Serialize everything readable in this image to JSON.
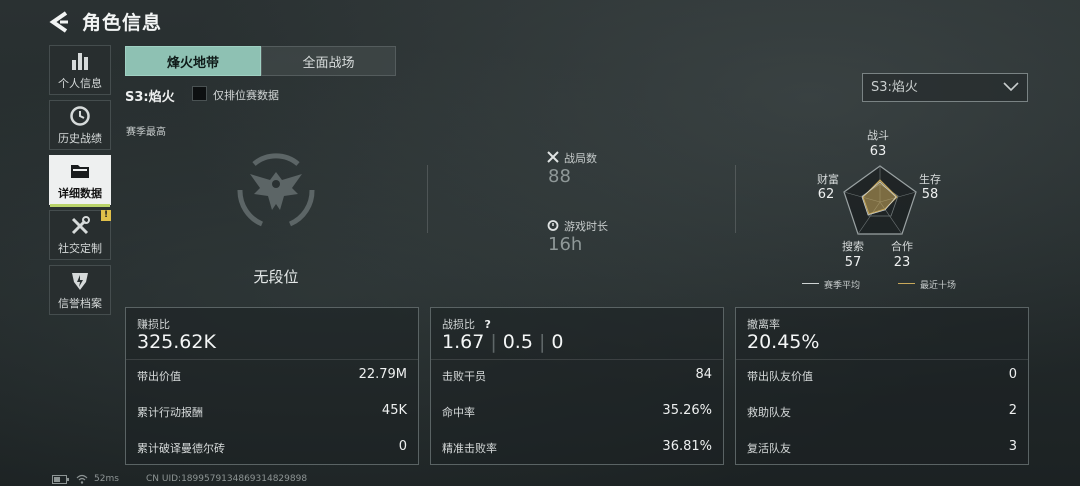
{
  "header": {
    "title": "角色信息"
  },
  "nav": [
    {
      "label": "个人信息",
      "icon": "bar-chart-icon"
    },
    {
      "label": "历史战绩",
      "icon": "clock-icon"
    },
    {
      "label": "详细数据",
      "icon": "folder-icon",
      "active": true
    },
    {
      "label": "社交定制",
      "icon": "tools-icon",
      "badge": "!"
    },
    {
      "label": "信誉档案",
      "icon": "shield-icon"
    }
  ],
  "tabs": [
    {
      "label": "烽火地带",
      "active": true
    },
    {
      "label": "全面战场",
      "active": false
    }
  ],
  "season": {
    "label": "S3:焰火",
    "checkbox_label": "仅排位赛数据",
    "checked": false
  },
  "season_select": {
    "value": "S3:焰火"
  },
  "section": {
    "label": "赛季最高",
    "rank": "无段位"
  },
  "stats": {
    "matches_label": "战局数",
    "matches_value": "88",
    "playtime_label": "游戏时长",
    "playtime_value": "16h"
  },
  "radar": {
    "combat_label": "战斗",
    "combat_value": "63",
    "survival_label": "生存",
    "survival_value": "58",
    "coop_label": "合作",
    "coop_value": "23",
    "search_label": "搜索",
    "search_value": "57",
    "wealth_label": "财富",
    "wealth_value": "62",
    "legend_season": "赛季平均",
    "legend_recent": "最近十场",
    "season_color": "#cfd4d4",
    "recent_color": "#c8a85a"
  },
  "cards": {
    "profit": {
      "title": "赚损比",
      "value": "325.62K",
      "rows": [
        {
          "label": "带出价值",
          "value": "22.79M"
        },
        {
          "label": "累计行动报酬",
          "value": "45K"
        },
        {
          "label": "累计破译曼德尔砖",
          "value": "0"
        }
      ]
    },
    "combat": {
      "title": "战损比",
      "help": "?",
      "value1": "1.67",
      "value2": "0.5",
      "value3": "0",
      "rows": [
        {
          "label": "击败干员",
          "value": "84"
        },
        {
          "label": "命中率",
          "value": "35.26%"
        },
        {
          "label": "精准击败率",
          "value": "36.81%"
        }
      ]
    },
    "extract": {
      "title": "撤离率",
      "value": "20.45%",
      "rows": [
        {
          "label": "带出队友价值",
          "value": "0"
        },
        {
          "label": "救助队友",
          "value": "2"
        },
        {
          "label": "复活队友",
          "value": "3"
        }
      ]
    }
  },
  "footer": {
    "ping": "52ms",
    "uid": "CN UID:1899579134869314829898"
  }
}
